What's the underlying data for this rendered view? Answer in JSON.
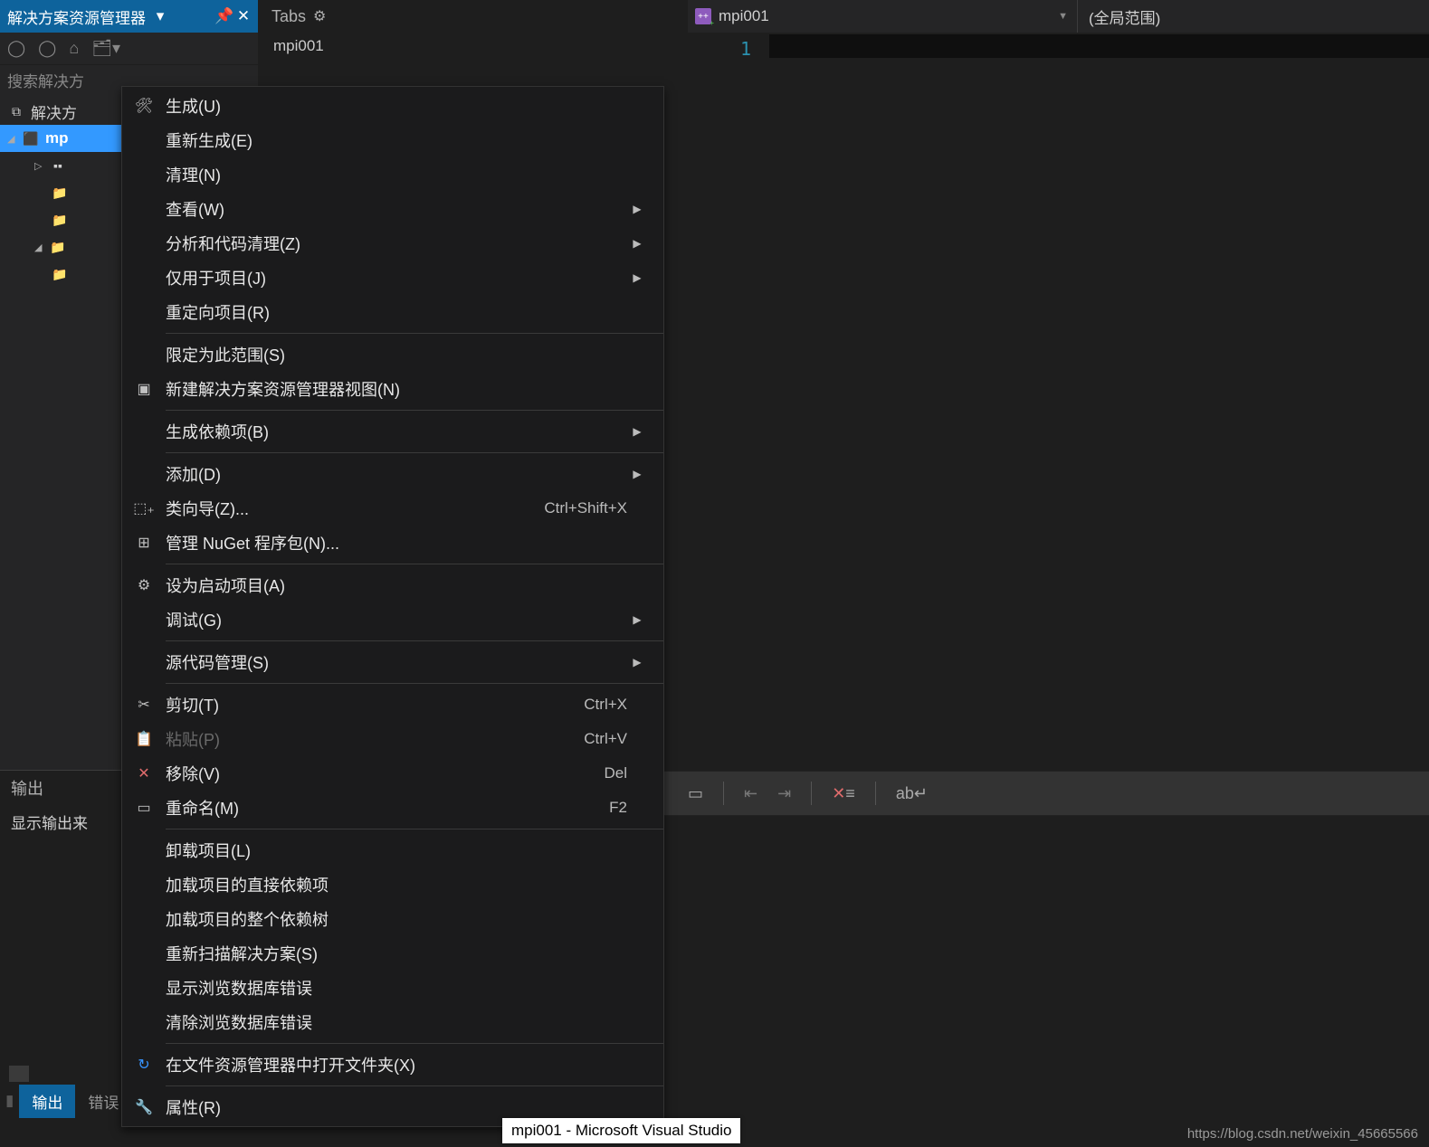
{
  "solution_explorer": {
    "title": "解决方案资源管理器",
    "search_placeholder": "搜索解决方",
    "tree": {
      "root": "解决方",
      "project": "mp"
    }
  },
  "tabs_panel": {
    "title": "Tabs",
    "open_file": "mpi001"
  },
  "editor": {
    "file_label": "mpi001",
    "scope_label": "(全局范围)",
    "line_number": "1"
  },
  "context_menu": {
    "items": [
      {
        "icon": "build",
        "label": "生成(U)",
        "shortcut": "",
        "arrow": false
      },
      {
        "icon": "",
        "label": "重新生成(E)",
        "shortcut": "",
        "arrow": false
      },
      {
        "icon": "",
        "label": "清理(N)",
        "shortcut": "",
        "arrow": false
      },
      {
        "icon": "",
        "label": "查看(W)",
        "shortcut": "",
        "arrow": true
      },
      {
        "icon": "",
        "label": "分析和代码清理(Z)",
        "shortcut": "",
        "arrow": true
      },
      {
        "icon": "",
        "label": "仅用于项目(J)",
        "shortcut": "",
        "arrow": true
      },
      {
        "icon": "",
        "label": "重定向项目(R)",
        "shortcut": "",
        "arrow": false
      },
      {
        "sep": true
      },
      {
        "icon": "",
        "label": "限定为此范围(S)",
        "shortcut": "",
        "arrow": false
      },
      {
        "icon": "newview",
        "label": "新建解决方案资源管理器视图(N)",
        "shortcut": "",
        "arrow": false
      },
      {
        "sep": true
      },
      {
        "icon": "",
        "label": "生成依赖项(B)",
        "shortcut": "",
        "arrow": true
      },
      {
        "sep": true
      },
      {
        "icon": "",
        "label": "添加(D)",
        "shortcut": "",
        "arrow": true
      },
      {
        "icon": "wizard",
        "label": "类向导(Z)...",
        "shortcut": "Ctrl+Shift+X",
        "arrow": false
      },
      {
        "icon": "nuget",
        "label": "管理 NuGet 程序包(N)...",
        "shortcut": "",
        "arrow": false
      },
      {
        "sep": true
      },
      {
        "icon": "gear",
        "label": "设为启动项目(A)",
        "shortcut": "",
        "arrow": false
      },
      {
        "icon": "",
        "label": "调试(G)",
        "shortcut": "",
        "arrow": true
      },
      {
        "sep": true
      },
      {
        "icon": "",
        "label": "源代码管理(S)",
        "shortcut": "",
        "arrow": true
      },
      {
        "sep": true
      },
      {
        "icon": "cut",
        "label": "剪切(T)",
        "shortcut": "Ctrl+X",
        "arrow": false
      },
      {
        "icon": "paste",
        "label": "粘贴(P)",
        "shortcut": "Ctrl+V",
        "arrow": false,
        "disabled": true
      },
      {
        "icon": "remove",
        "label": "移除(V)",
        "shortcut": "Del",
        "arrow": false
      },
      {
        "icon": "rename",
        "label": "重命名(M)",
        "shortcut": "F2",
        "arrow": false
      },
      {
        "sep": true
      },
      {
        "icon": "",
        "label": "卸载项目(L)",
        "shortcut": "",
        "arrow": false
      },
      {
        "icon": "",
        "label": "加载项目的直接依赖项",
        "shortcut": "",
        "arrow": false
      },
      {
        "icon": "",
        "label": "加载项目的整个依赖树",
        "shortcut": "",
        "arrow": false
      },
      {
        "icon": "",
        "label": "重新扫描解决方案(S)",
        "shortcut": "",
        "arrow": false
      },
      {
        "icon": "",
        "label": "显示浏览数据库错误",
        "shortcut": "",
        "arrow": false
      },
      {
        "icon": "",
        "label": "清除浏览数据库错误",
        "shortcut": "",
        "arrow": false
      },
      {
        "sep": true
      },
      {
        "icon": "open",
        "label": "在文件资源管理器中打开文件夹(X)",
        "shortcut": "",
        "arrow": false
      },
      {
        "sep": true
      },
      {
        "icon": "wrench",
        "label": "属性(R)",
        "shortcut": "",
        "arrow": false
      }
    ]
  },
  "output": {
    "title": "输出",
    "source_label": "显示输出来"
  },
  "bottom_tabs": {
    "active": "输出",
    "other": "错误"
  },
  "taskbar_tooltip": "mpi001 - Microsoft Visual Studio",
  "watermark": "https://blog.csdn.net/weixin_45665566",
  "icons": {
    "build": "⚙",
    "newview": "▦",
    "wizard": "⬚",
    "nuget": "⊞",
    "gear": "⚙",
    "cut": "✂",
    "paste": "📋",
    "remove": "✕",
    "rename": "▭",
    "open": "↻",
    "wrench": "🔧"
  }
}
